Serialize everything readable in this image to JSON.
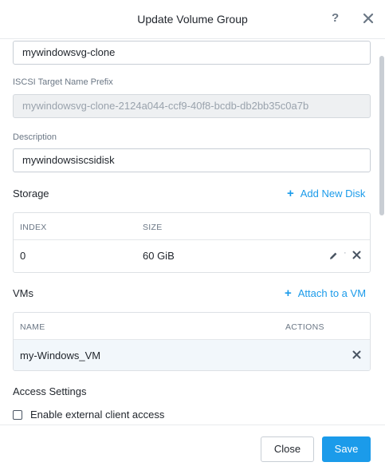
{
  "header": {
    "title": "Update Volume Group",
    "help_label": "?"
  },
  "form": {
    "name_value": "mywindowsvg-clone",
    "iscsi_label": "ISCSI Target Name Prefix",
    "iscsi_value": "mywindowsvg-clone-2124a044-ccf9-40f8-bcdb-db2bb35c0a7b",
    "description_label": "Description",
    "description_value": "mywindowsiscsidisk"
  },
  "storage": {
    "title": "Storage",
    "add_disk_label": "Add New Disk",
    "columns": [
      "INDEX",
      "SIZE"
    ],
    "rows": [
      {
        "index": "0",
        "size": "60 GiB"
      }
    ]
  },
  "vms": {
    "title": "VMs",
    "attach_label": "Attach to a VM",
    "columns": [
      "NAME",
      "ACTIONS"
    ],
    "rows": [
      {
        "name": "my-Windows_VM"
      }
    ]
  },
  "access": {
    "title": "Access Settings",
    "external_access_label": "Enable external client access",
    "external_access_checked": false
  },
  "footer": {
    "close_label": "Close",
    "save_label": "Save"
  },
  "icons": {
    "close": "close-icon",
    "edit": "pencil-icon",
    "remove": "x-icon",
    "add": "plus-icon"
  },
  "colors": {
    "accent": "#1b9bea",
    "text": "#22272e",
    "muted": "#6b7785"
  }
}
